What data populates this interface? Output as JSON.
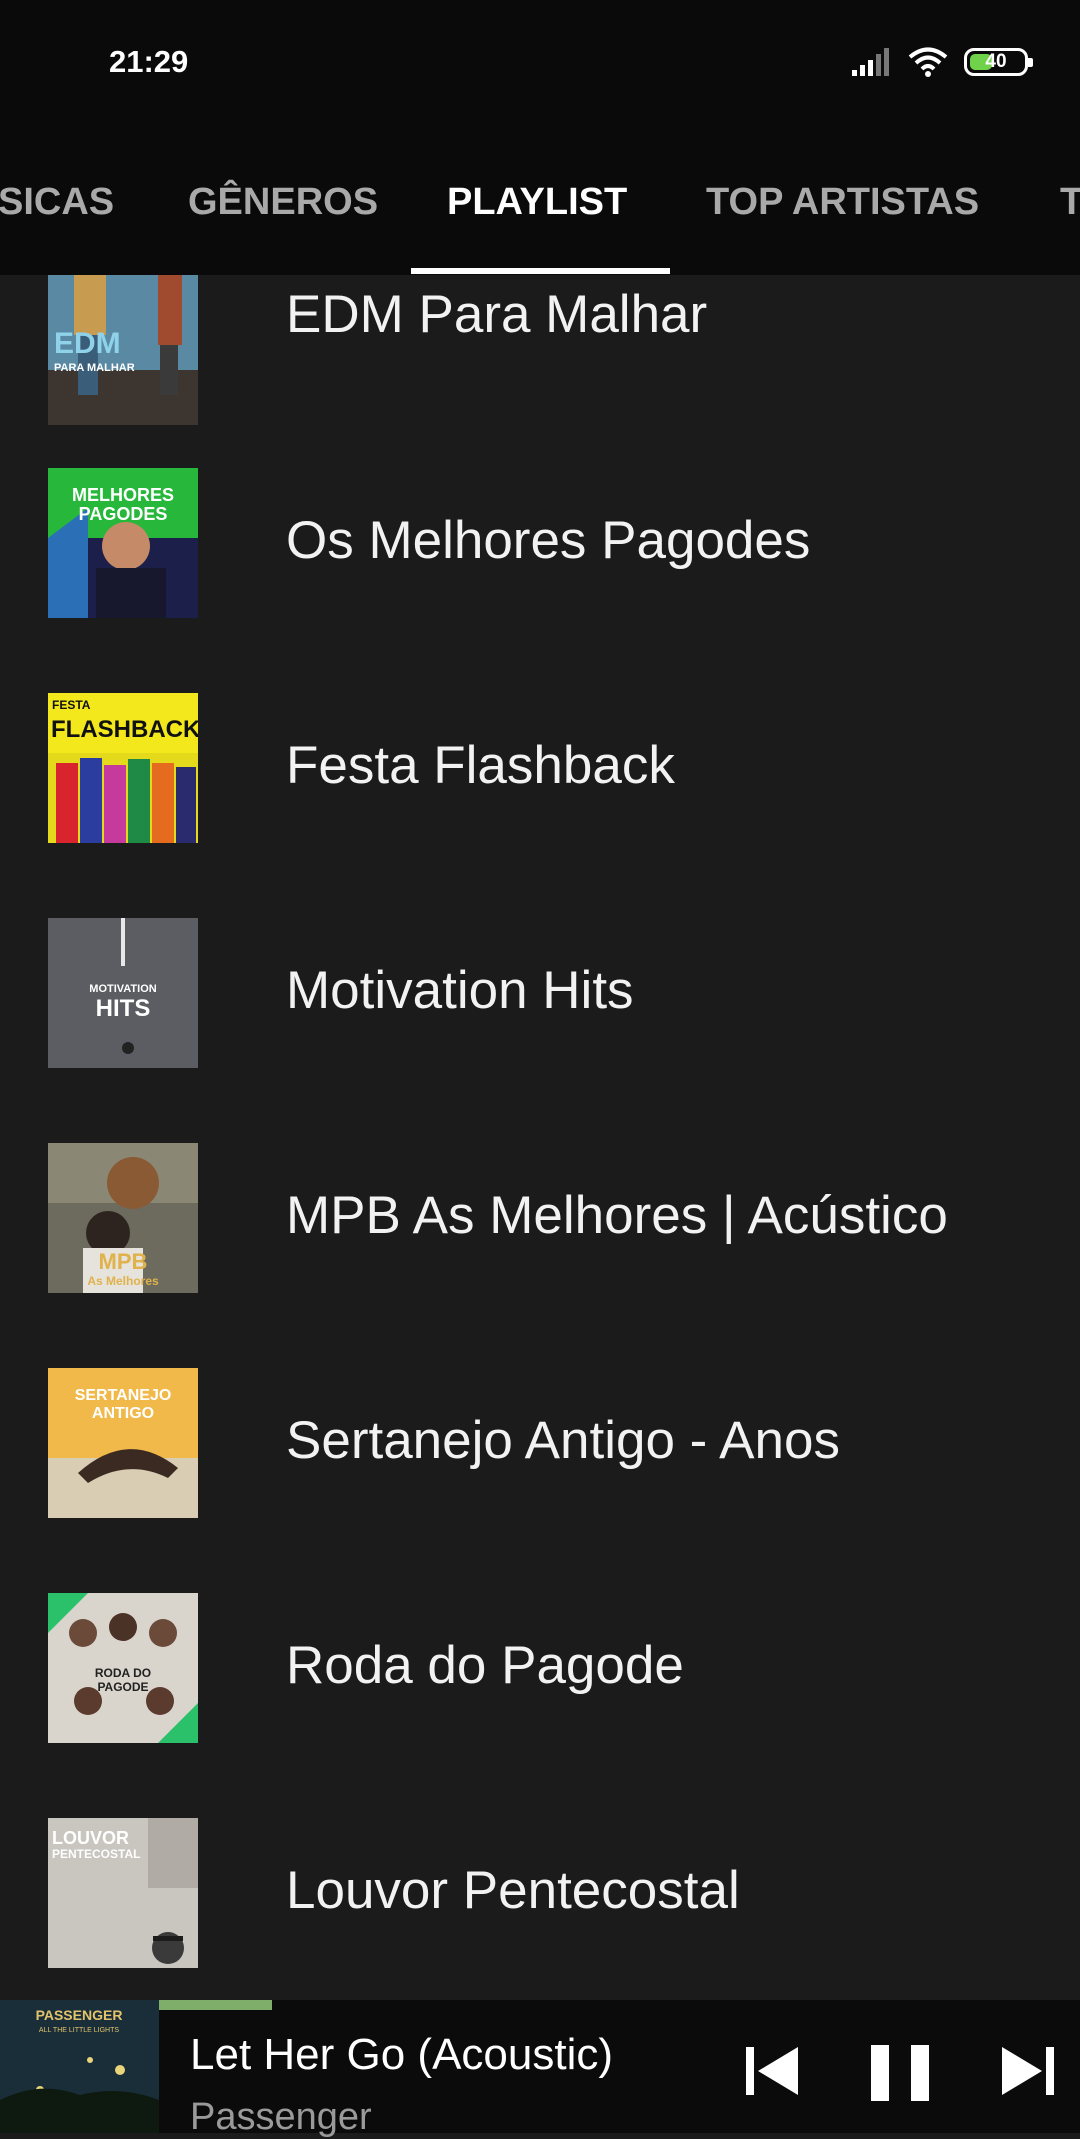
{
  "status_bar": {
    "time": "21:29",
    "battery": "40",
    "icons": [
      "signal-icon",
      "wifi-icon",
      "battery-icon"
    ],
    "battery_color": "#6fd24a"
  },
  "tabs": [
    {
      "label": "SICAS",
      "active": false
    },
    {
      "label": "GÊNEROS",
      "active": false
    },
    {
      "label": "PLAYLIST",
      "active": true
    },
    {
      "label": "TOP ARTISTAS",
      "active": false
    },
    {
      "label": "T",
      "active": false
    }
  ],
  "playlists": [
    {
      "title": "EDM Para Malhar",
      "cover_text": [
        "EDM",
        "PARA MALHAR"
      ]
    },
    {
      "title": "Os Melhores Pagodes",
      "cover_text": [
        "MELHORES",
        "PAGODES"
      ]
    },
    {
      "title": "Festa Flashback",
      "cover_text": [
        "FESTA",
        "FLASHBACK"
      ]
    },
    {
      "title": "Motivation Hits",
      "cover_text": [
        "MOTIVATION",
        "HITS"
      ]
    },
    {
      "title": "MPB As Melhores | Acústico",
      "cover_text": [
        "MPB",
        "As Melhores"
      ]
    },
    {
      "title": "Sertanejo Antigo - Anos",
      "cover_text": [
        "SERTANEJO",
        "ANTIGO"
      ]
    },
    {
      "title": "Roda do Pagode",
      "cover_text": [
        "RODA DO",
        "PAGODE"
      ]
    },
    {
      "title": "Louvor Pentecostal",
      "cover_text": [
        "LOUVOR",
        "PENTECOSTAL"
      ]
    }
  ],
  "now_playing": {
    "title": "Let Her Go (Acoustic)",
    "artist": "Passenger",
    "cover_text": [
      "PASSENGER",
      "ALL THE LITTLE LIGHTS"
    ],
    "progress_color": "#7fae6a",
    "controls": [
      "previous-icon",
      "pause-icon",
      "next-icon"
    ]
  }
}
